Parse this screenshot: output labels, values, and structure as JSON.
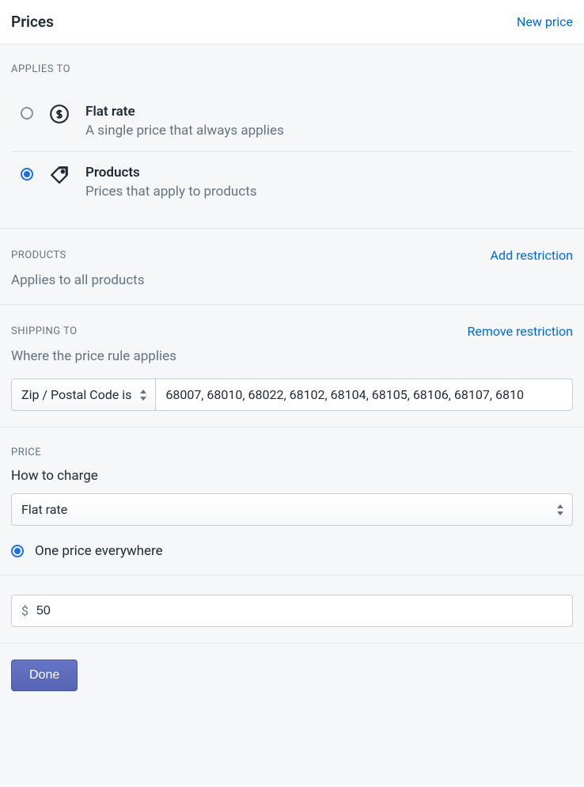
{
  "header": {
    "title": "Prices",
    "action": "New price"
  },
  "applies_to": {
    "label": "APPLIES TO",
    "options": [
      {
        "title": "Flat rate",
        "description": "A single price that always applies",
        "checked": false
      },
      {
        "title": "Products",
        "description": "Prices that apply to products",
        "checked": true
      }
    ]
  },
  "products": {
    "label": "PRODUCTS",
    "action": "Add restriction",
    "summary": "Applies to all products"
  },
  "shipping": {
    "label": "SHIPPING TO",
    "action": "Remove restriction",
    "summary": "Where the price rule applies",
    "selector": "Zip / Postal Code is",
    "value": "68007, 68010, 68022, 68102, 68104, 68105, 68106, 68107, 6810"
  },
  "price": {
    "label": "PRICE",
    "how_label": "How to charge",
    "how_value": "Flat rate",
    "scope_label": "One price everywhere",
    "currency": "$",
    "amount": "50"
  },
  "footer": {
    "done": "Done"
  }
}
